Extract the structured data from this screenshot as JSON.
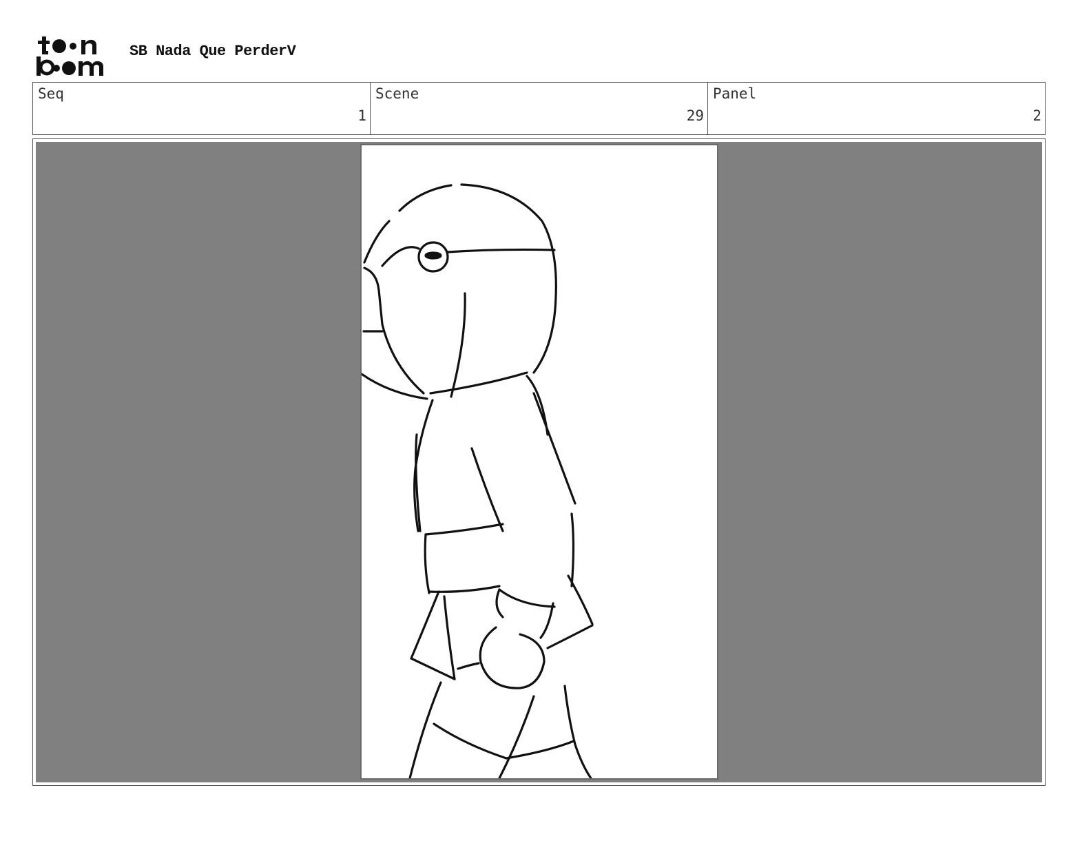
{
  "header": {
    "logo_text": "toon boom",
    "title": "SB Nada Que PerderV"
  },
  "info": {
    "seq_label": "Seq",
    "seq_value": "1",
    "scene_label": "Scene",
    "scene_value": "29",
    "panel_label": "Panel",
    "panel_value": "2"
  },
  "panel": {
    "background_color": "#808080",
    "canvas_color": "#ffffff",
    "drawing": "character-sketch-profile"
  }
}
